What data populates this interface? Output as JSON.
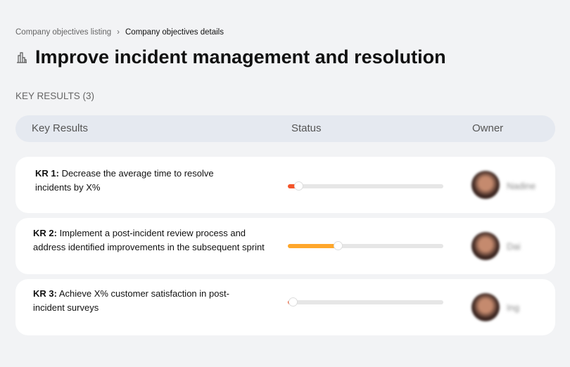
{
  "breadcrumb": {
    "items": [
      "Company objectives listing",
      "Company objectives details"
    ],
    "separator": "›"
  },
  "page": {
    "title": "Improve incident management and resolution",
    "icon": "buildings-icon"
  },
  "section": {
    "label": "KEY RESULTS (3)"
  },
  "table": {
    "headers": {
      "key_results": "Key Results",
      "status": "Status",
      "owner": "Owner"
    },
    "rows": [
      {
        "id": "KR 1:",
        "text": " Decrease the average time to resolve incidents by X%",
        "progress_percent": 7,
        "color": "#f4552a",
        "owner": "Nadine"
      },
      {
        "id": "KR 2:",
        "text": " Implement a post-incident review process and address identified improvements in the subsequent sprint",
        "progress_percent": 32,
        "color": "#ffa72b",
        "owner": "Dai"
      },
      {
        "id": "KR 3:",
        "text": " Achieve X% customer satisfaction in post-incident surveys",
        "progress_percent": 3,
        "color": "#f4552a",
        "owner": "Ing"
      }
    ]
  }
}
